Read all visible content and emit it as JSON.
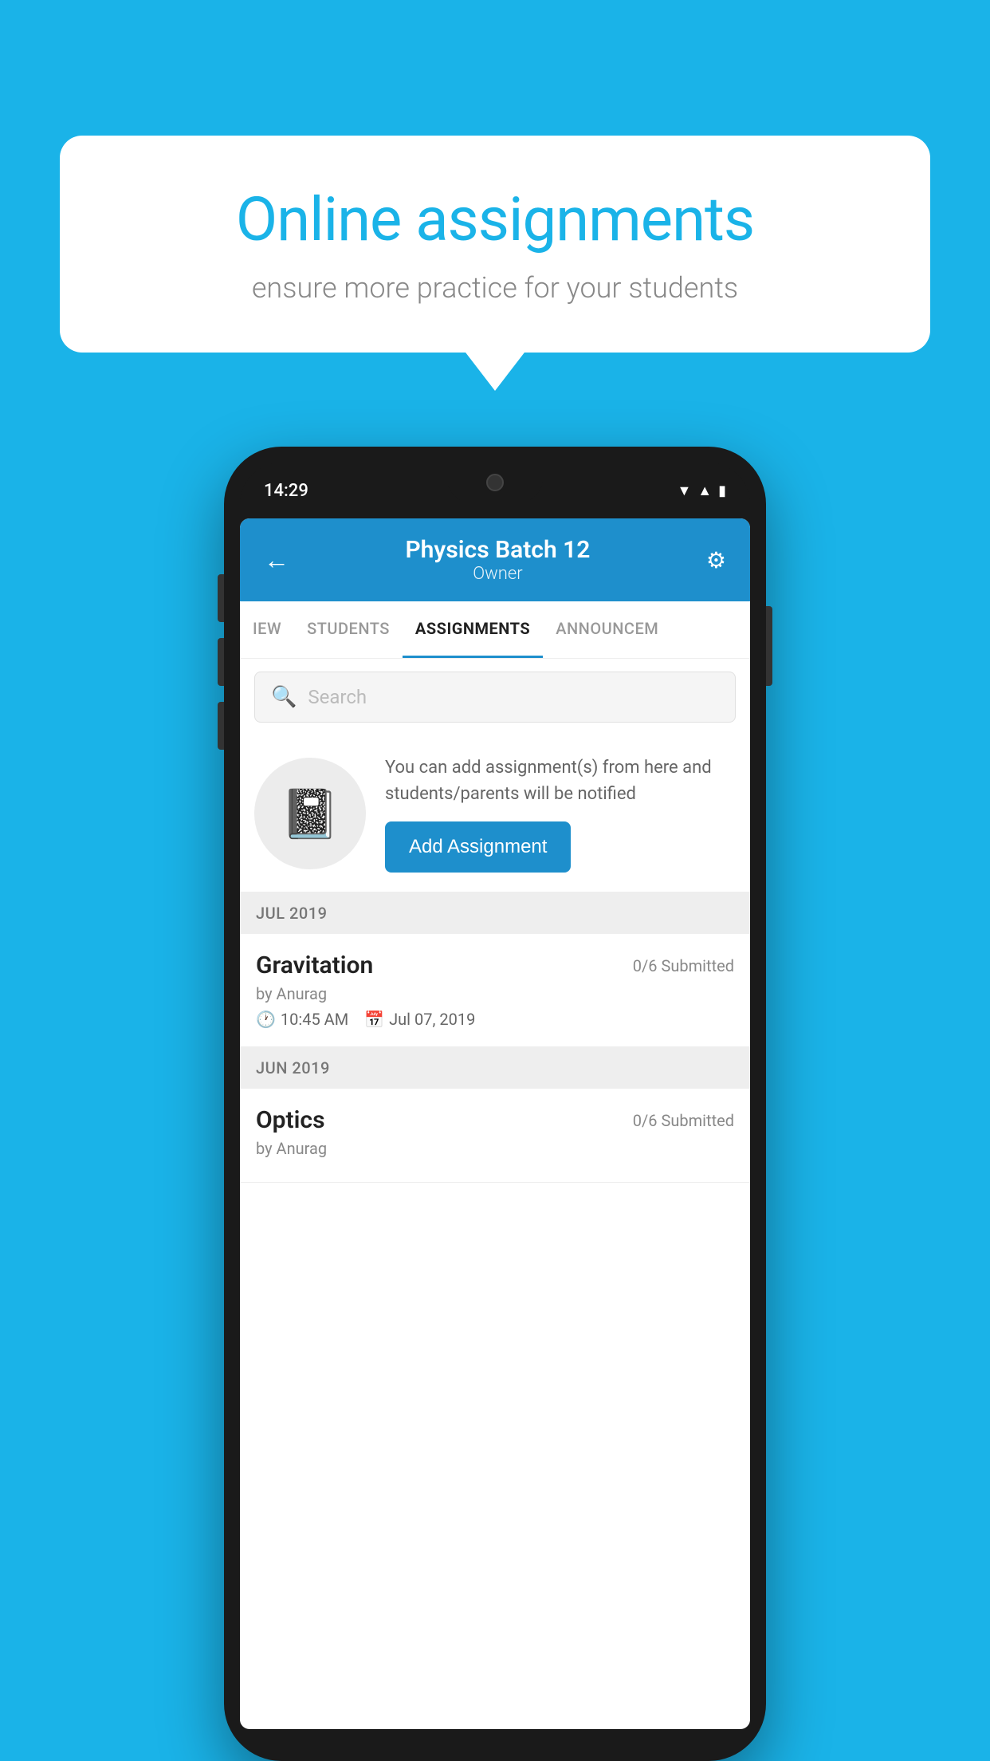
{
  "background_color": "#1ab3e8",
  "speech_bubble": {
    "title": "Online assignments",
    "subtitle": "ensure more practice for your students"
  },
  "phone": {
    "status_bar": {
      "time": "14:29",
      "icons": [
        "wifi",
        "signal",
        "battery"
      ]
    },
    "header": {
      "title": "Physics Batch 12",
      "subtitle": "Owner",
      "back_label": "←",
      "settings_label": "⚙"
    },
    "tabs": [
      {
        "label": "IEW",
        "active": false
      },
      {
        "label": "STUDENTS",
        "active": false
      },
      {
        "label": "ASSIGNMENTS",
        "active": true
      },
      {
        "label": "ANNOUNCEM",
        "active": false
      }
    ],
    "search": {
      "placeholder": "Search"
    },
    "empty_state": {
      "description": "You can add assignment(s) from here and students/parents will be notified",
      "button_label": "Add Assignment"
    },
    "sections": [
      {
        "header": "JUL 2019",
        "assignments": [
          {
            "name": "Gravitation",
            "submitted": "0/6 Submitted",
            "author": "by Anurag",
            "time": "10:45 AM",
            "date": "Jul 07, 2019"
          }
        ]
      },
      {
        "header": "JUN 2019",
        "assignments": [
          {
            "name": "Optics",
            "submitted": "0/6 Submitted",
            "author": "by Anurag",
            "time": "",
            "date": ""
          }
        ]
      }
    ]
  }
}
